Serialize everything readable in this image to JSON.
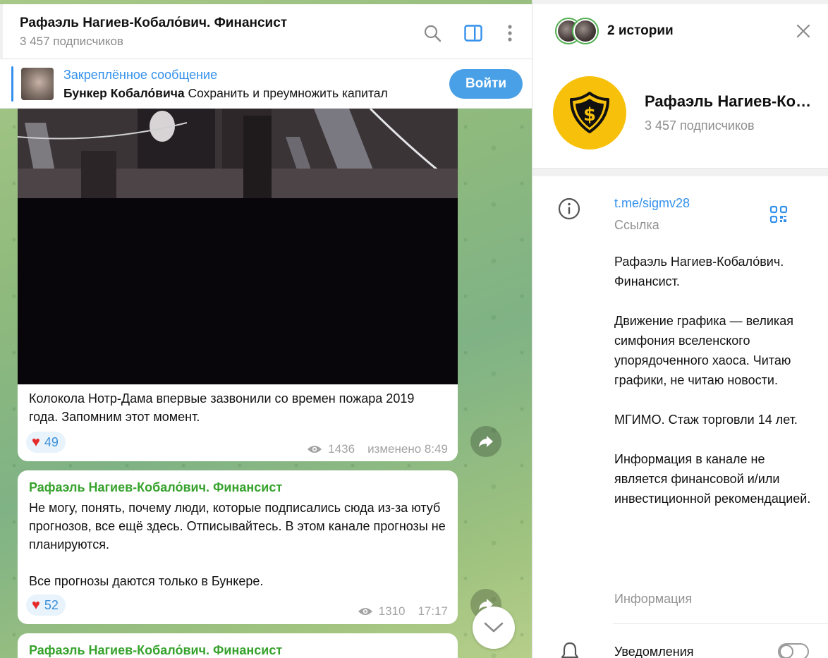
{
  "chat": {
    "title": "Рафаэль Нагиев-Кобало́вич. Финансист",
    "subscribers": "3 457 подписчиков",
    "pinned": {
      "label": "Закреплённое сообщение",
      "bold": "Бункер Кобало́вича",
      "text": " Сохранить и преумножить капитал"
    },
    "join_label": "Войти",
    "messages": [
      {
        "text": "Колокола Нотр-Дама впервые зазвонили со времен пожара 2019 года. Запомним этот момент.",
        "reaction_count": "49",
        "views": "1436",
        "time": "изменено 8:49"
      },
      {
        "sender": "Рафаэль Нагиев-Кобало́вич. Финансист",
        "text": "Не могу, понять, почему люди, которые подписались сюда из-за ютуб прогнозов, все ещё здесь. Отписывайтесь. В этом канале прогнозы не планируются.\n\nВсе прогнозы даются только в Бункере.",
        "reaction_count": "52",
        "views": "1310",
        "time": "17:17"
      },
      {
        "sender": "Рафаэль Нагиев-Кобало́вич. Финансист"
      }
    ]
  },
  "panel": {
    "stories_label": "2 истории",
    "channel_name": "Рафаэль Нагиев-Кобало́вич. Финансист",
    "subscribers": "3 457 подписчиков",
    "link": "t.me/sigmv28",
    "link_label": "Ссылка",
    "bio": "Рафаэль Нагиев-Кобало́вич. Финансист.\n\nДвижение графика — великая симфония вселенского упорядоченного хаоса. Читаю графики, не читаю новости.\n\nМГИМО. Стаж торговли 14 лет.\n\nИнформация в канале не является финансовой и/или инвестиционной рекомендацией.",
    "bio_label": "Информация",
    "notifications_label": "Уведомления"
  },
  "colors": {
    "accent": "#3390ec",
    "sender": "#36a22c",
    "avatar_bg": "#f7c10b",
    "heart": "#e52a2a"
  },
  "icons": {
    "search": "search-icon",
    "sidebar_toggle": "sidebar-toggle-icon",
    "more": "more-vertical-icon",
    "close": "close-icon",
    "info": "info-icon",
    "qr": "qr-code-icon",
    "bell": "bell-icon",
    "share": "share-icon",
    "scroll_down": "chevron-down-icon",
    "eye": "eye-icon",
    "heart": "heart-icon"
  }
}
